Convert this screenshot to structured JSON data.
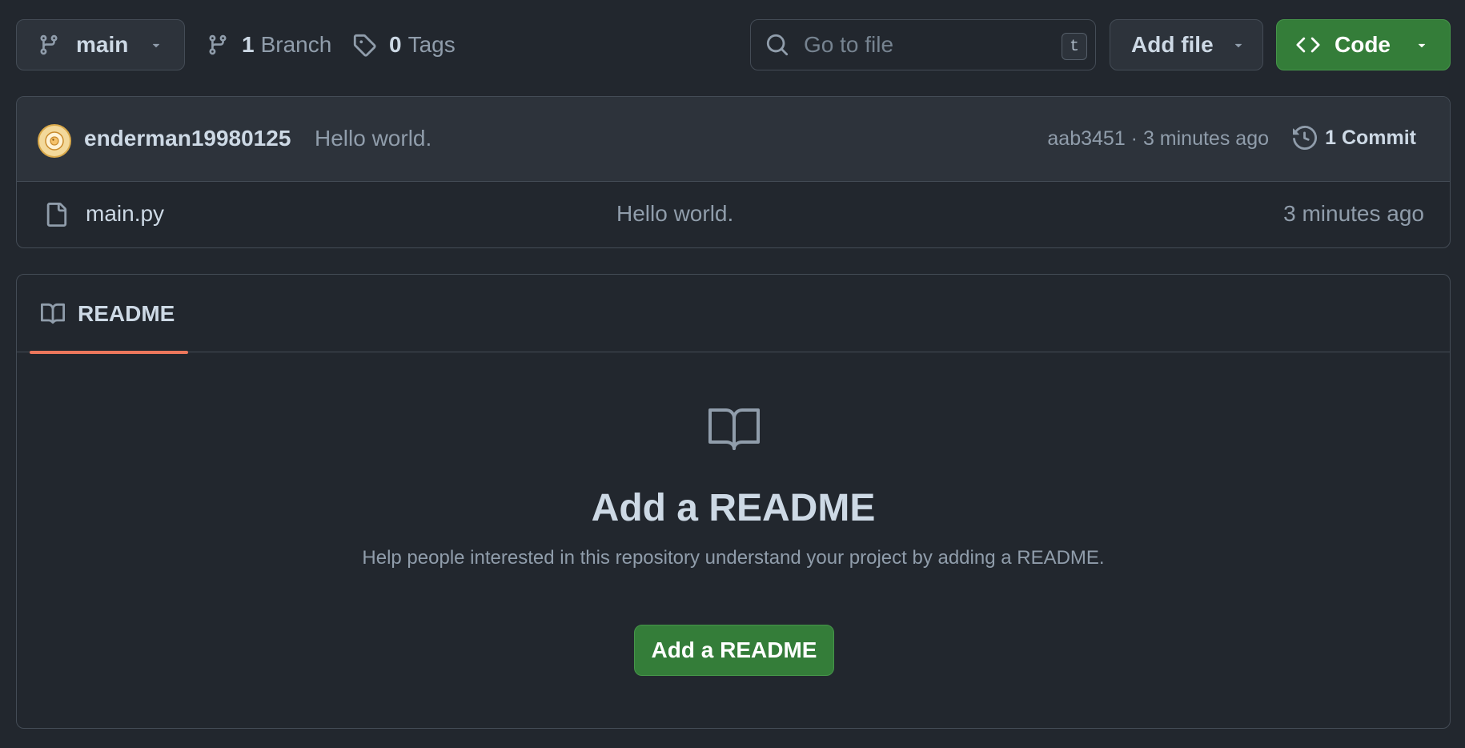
{
  "colors": {
    "background": "#22272e",
    "surface": "#2d333b",
    "border": "#444c56",
    "primary_button": "#347d39",
    "tab_underline": "#ec775c",
    "text_primary": "#cdd9e5",
    "text_muted": "#909dab"
  },
  "toolbar": {
    "branch_selector": {
      "label": "main",
      "icon": "git-branch-icon",
      "caret": "triangle-down-icon"
    },
    "branches": {
      "count": "1",
      "label": "Branch",
      "icon": "git-branch-icon"
    },
    "tags": {
      "count": "0",
      "label": "Tags",
      "icon": "tag-icon"
    },
    "search": {
      "placeholder": "Go to file",
      "value": "",
      "shortcut": "t",
      "icon": "search-icon"
    },
    "add_file": {
      "label": "Add file",
      "caret": "triangle-down-icon"
    },
    "code": {
      "label": "Code",
      "icon": "code-icon",
      "caret": "triangle-down-icon"
    }
  },
  "latest_commit": {
    "author": "enderman19980125",
    "message": "Hello world.",
    "sha": "aab3451",
    "separator": "·",
    "time": "3 minutes ago",
    "commits_label": "1 Commit",
    "history_icon": "history-icon"
  },
  "files": [
    {
      "name": "main.py",
      "commit_message": "Hello world.",
      "time": "3 minutes ago",
      "icon": "file-icon"
    }
  ],
  "readme": {
    "tab_label": "README",
    "tab_icon": "book-icon",
    "empty_icon": "book-icon",
    "title": "Add a README",
    "description": "Help people interested in this repository understand your project by adding a README.",
    "button_label": "Add a README"
  }
}
